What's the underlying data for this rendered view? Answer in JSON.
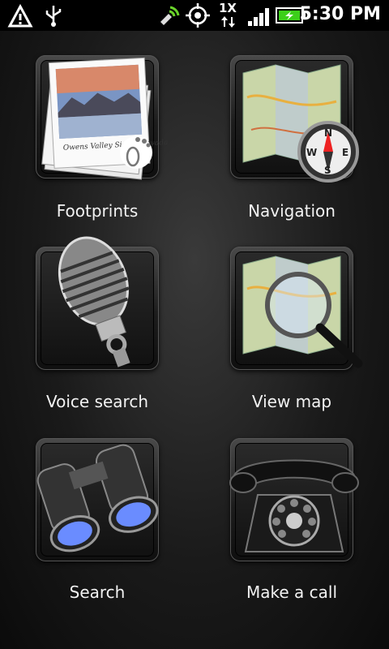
{
  "status_bar": {
    "time": "5:30 PM",
    "network_label": "1X",
    "icons": [
      "warning-icon",
      "usb-icon",
      "satellite-icon",
      "gps-icon",
      "network-arrows-icon",
      "signal-icon",
      "battery-icon"
    ]
  },
  "apps": [
    {
      "name": "footprints",
      "label": "Footprints",
      "icon": "photo-stack-icon",
      "photo_caption": "Owens Valley Sierra Nevada"
    },
    {
      "name": "navigation",
      "label": "Navigation",
      "icon": "map-compass-icon",
      "compass_letters": [
        "N",
        "E",
        "S",
        "W"
      ]
    },
    {
      "name": "voice-search",
      "label": "Voice search",
      "icon": "microphone-icon"
    },
    {
      "name": "view-map",
      "label": "View map",
      "icon": "map-magnifier-icon"
    },
    {
      "name": "search",
      "label": "Search",
      "icon": "binoculars-icon"
    },
    {
      "name": "make-a-call",
      "label": "Make a call",
      "icon": "rotary-phone-icon"
    }
  ],
  "colors": {
    "background": "#1e1e1e",
    "status_bar": "#000000",
    "label_text": "#f2f2f2",
    "battery_green": "#3ccf1a",
    "lens_blue": "#6a8cff"
  }
}
